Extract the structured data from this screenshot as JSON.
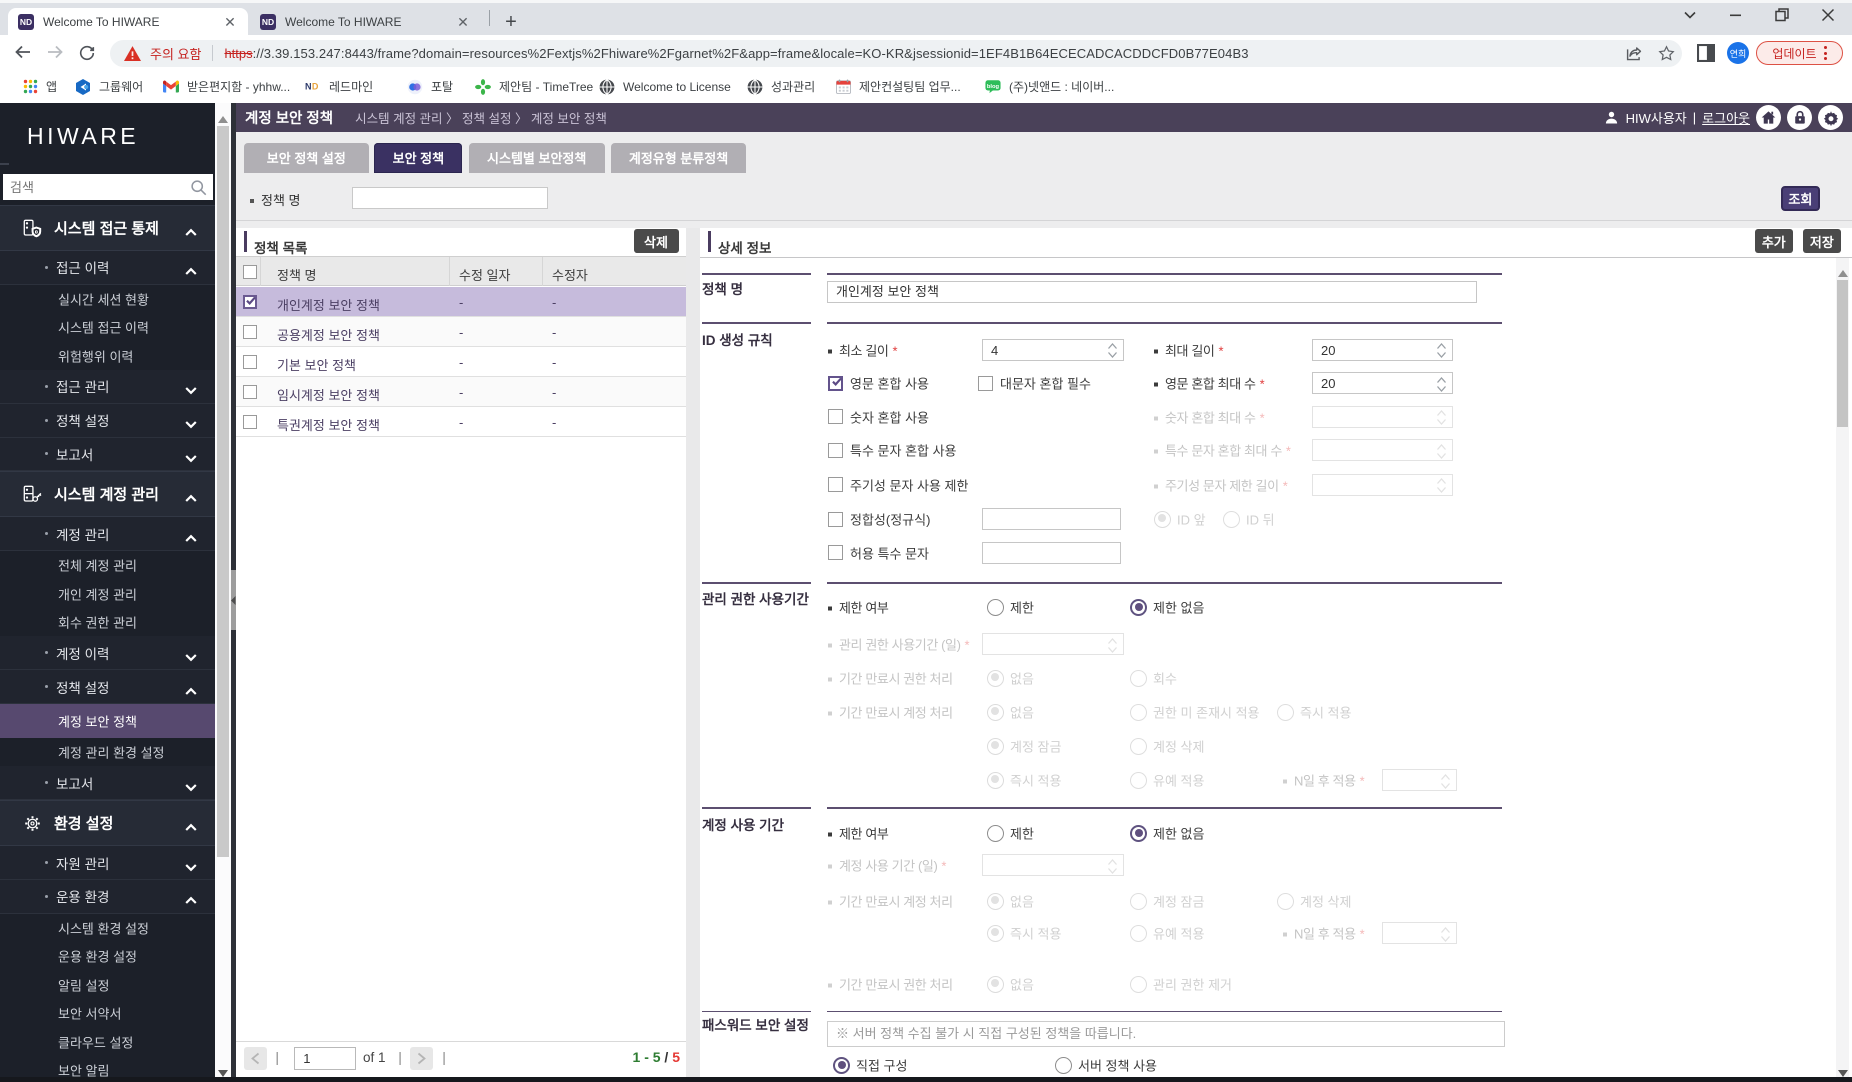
{
  "browser": {
    "tabs": [
      {
        "title": "Welcome To HIWARE",
        "favicon": "ND",
        "active": true
      },
      {
        "title": "Welcome To HIWARE",
        "favicon": "ND",
        "active": false
      }
    ],
    "new_tab_label": "+",
    "omnibox": {
      "warning_icon": "warning-triangle",
      "warning_text": "주의 요함",
      "scheme_struck": "https",
      "url_rest": "://3.39.153.247:8443/frame?domain=resources%2Fextjs%2Fhiware%2Fgarnet%2F&app=frame&locale=KO-KR&jsessionid=1EF4B1B64ECECADCACDDCFD0B77E04B3"
    },
    "avatar_label": "연희",
    "update_label": "업데이트",
    "bookmarks": [
      {
        "icon": "apps-grid",
        "label": "앱"
      },
      {
        "icon": "groupware",
        "label": "그룹웨어"
      },
      {
        "icon": "gmail",
        "label": "받은편지함 - yhhw..."
      },
      {
        "icon": "nd-logo",
        "label": "레드마인"
      },
      {
        "icon": "portal",
        "label": "포탈"
      },
      {
        "icon": "timetree",
        "label": "제안팀 - TimeTree"
      },
      {
        "icon": "globe",
        "label": "Welcome to License"
      },
      {
        "icon": "globe",
        "label": "성과관리"
      },
      {
        "icon": "calendar",
        "label": "제안컨설팅팀 업무..."
      },
      {
        "icon": "blog",
        "label": "(주)넷앤드 : 네이버..."
      }
    ]
  },
  "sidebar": {
    "logo": "HIWARE",
    "search_placeholder": "검색",
    "items": [
      {
        "type": "group",
        "icon": "server-shield",
        "label": "시스템 접근 통제",
        "chevron": "up"
      },
      {
        "type": "l2",
        "label": "접근 이력",
        "chevron": "up"
      },
      {
        "type": "l3",
        "label": "실시간 세션 현황"
      },
      {
        "type": "l3",
        "label": "시스템 접근 이력"
      },
      {
        "type": "l3",
        "label": "위험행위 이력"
      },
      {
        "type": "l2",
        "label": "접근 관리",
        "chevron": "down"
      },
      {
        "type": "l2",
        "label": "정책 설정",
        "chevron": "down"
      },
      {
        "type": "l2",
        "label": "보고서",
        "chevron": "down"
      },
      {
        "type": "group",
        "icon": "server-key",
        "label": "시스템 계정 관리",
        "chevron": "up"
      },
      {
        "type": "l2",
        "label": "계정 관리",
        "chevron": "up"
      },
      {
        "type": "l3",
        "label": "전체 계정 관리"
      },
      {
        "type": "l3",
        "label": "개인 계정 관리"
      },
      {
        "type": "l3",
        "label": "회수 권한 관리"
      },
      {
        "type": "l2",
        "label": "계정 이력",
        "chevron": "down"
      },
      {
        "type": "l2",
        "label": "정책 설정",
        "chevron": "up"
      },
      {
        "type": "l3",
        "label": "계정 보안 정책",
        "selected": true
      },
      {
        "type": "l3",
        "label": "계정 관리 환경 설정"
      },
      {
        "type": "l2",
        "label": "보고서",
        "chevron": "down"
      },
      {
        "type": "group",
        "icon": "gear",
        "label": "환경 설정",
        "chevron": "up"
      },
      {
        "type": "l2",
        "label": "자원 관리",
        "chevron": "down"
      },
      {
        "type": "l2",
        "label": "운용 환경",
        "chevron": "up"
      },
      {
        "type": "l3",
        "label": "시스템 환경 설정"
      },
      {
        "type": "l3",
        "label": "운용 환경 설정"
      },
      {
        "type": "l3",
        "label": "알림 설정"
      },
      {
        "type": "l3",
        "label": "보안 서약서"
      },
      {
        "type": "l3",
        "label": "클라우드 설정"
      },
      {
        "type": "l3",
        "label": "보안 알림"
      }
    ]
  },
  "header": {
    "title": "계정 보안 정책",
    "breadcrumb": "시스템 계정 관리 〉 정책 설정 〉 계정 보안 정책",
    "user_icon": "person",
    "user": "HIW사용자",
    "logout": "로그아웃",
    "icons": [
      "home",
      "lock",
      "gear"
    ]
  },
  "module_tabs": [
    {
      "label": "보안 정책 설정",
      "active": false
    },
    {
      "label": "보안 정책",
      "active": true
    },
    {
      "label": "시스템별 보안정책",
      "active": false
    },
    {
      "label": "계정유형 분류정책",
      "active": false
    }
  ],
  "filter": {
    "label": "정책 명",
    "value": "",
    "search_label": "조회"
  },
  "policy_list": {
    "title": "정책 목록",
    "delete_label": "삭제",
    "columns": [
      "정책 명",
      "수정 일자",
      "수정자"
    ],
    "rows": [
      {
        "name": "개인계정 보안 정책",
        "date": "-",
        "editor": "-",
        "checked": true,
        "selected": true
      },
      {
        "name": "공용계정 보안 정책",
        "date": "-",
        "editor": "-",
        "checked": false,
        "selected": false
      },
      {
        "name": "기본 보안 정책",
        "date": "-",
        "editor": "-",
        "checked": false,
        "selected": false
      },
      {
        "name": "임시계정 보안 정책",
        "date": "-",
        "editor": "-",
        "checked": false,
        "selected": false
      },
      {
        "name": "특권계정 보안 정책",
        "date": "-",
        "editor": "-",
        "checked": false,
        "selected": false
      }
    ],
    "pagination": {
      "page": "1",
      "of_label": "of 1",
      "range": "1 - 5",
      "slash": "/",
      "total": "5"
    }
  },
  "detail": {
    "title": "상세 정보",
    "add_label": "추가",
    "save_label": "저장",
    "sections": [
      {
        "title": "정책 명",
        "rows": [
          [
            {
              "k": "text",
              "v": "개인계정 보안 정책"
            }
          ]
        ]
      },
      {
        "title": "ID 생성 규칙",
        "rows": [
          [
            {
              "k": "blabel",
              "t": "최소 길이",
              "req": true
            },
            {
              "k": "spin",
              "v": "4"
            },
            {
              "k": "blabel2",
              "t": "최대 길이",
              "req": true
            },
            {
              "k": "spin2",
              "v": "20"
            }
          ],
          [
            {
              "k": "cb",
              "t": "영문 혼합 사용",
              "checked": true
            },
            {
              "k": "cb2",
              "t": "대문자 혼합 필수"
            },
            {
              "k": "blabel2",
              "t": "영문 혼합 최대 수",
              "req": true
            },
            {
              "k": "spin2",
              "v": "20"
            }
          ],
          [
            {
              "k": "cb",
              "t": "숫자 혼합 사용"
            },
            {
              "k": "blabel2",
              "t": "숫자 혼합 최대 수",
              "req": true,
              "dis": true
            },
            {
              "k": "spin2",
              "dis": true
            }
          ],
          [
            {
              "k": "cb",
              "t": "특수 문자 혼합 사용"
            },
            {
              "k": "blabel2",
              "t": "특수 문자 혼합 최대 수",
              "req": true,
              "dis": true
            },
            {
              "k": "spin2",
              "dis": true
            }
          ],
          [
            {
              "k": "cb",
              "t": "주기성 문자 사용 제한"
            },
            {
              "k": "blabel2",
              "t": "주기성 문자 제한 길이",
              "req": true,
              "dis": true
            },
            {
              "k": "spin2",
              "dis": true
            }
          ],
          [
            {
              "k": "cb",
              "t": "정합성(정규식)"
            },
            {
              "k": "smalltext"
            },
            {
              "k": "idradio1",
              "t": "ID 앞",
              "state": "dison"
            },
            {
              "k": "idradio2",
              "t": "ID 뒤",
              "state": "dis"
            }
          ],
          [
            {
              "k": "cb",
              "t": "허용 특수 문자"
            },
            {
              "k": "smalltext"
            }
          ]
        ]
      },
      {
        "title": "관리 권한 사용기간",
        "rows": [
          [
            {
              "k": "blabel",
              "t": "제한 여부"
            },
            {
              "k": "radioA",
              "t": "제한",
              "state": "off"
            },
            {
              "k": "radioB",
              "t": "제한 없음",
              "state": "on"
            }
          ],
          [
            {
              "k": "blabel",
              "t": "관리 권한 사용기간 (일)",
              "req": true,
              "dis": true
            },
            {
              "k": "spin",
              "dis": true
            }
          ],
          [
            {
              "k": "blabel",
              "t": "기간 만료시 권한 처리",
              "dis": true
            },
            {
              "k": "radioA",
              "t": "없음",
              "state": "dison"
            },
            {
              "k": "radioB",
              "t": "회수",
              "state": "dis"
            }
          ],
          [
            {
              "k": "blabel",
              "t": "기간 만료시 계정 처리",
              "dis": true
            },
            {
              "k": "radioA",
              "t": "없음",
              "state": "dison"
            },
            {
              "k": "radioB",
              "t": "권한 미 존재시 적용",
              "state": "dis"
            },
            {
              "k": "radioC",
              "t": "즉시 적용",
              "state": "dis"
            }
          ],
          [
            {
              "k": "radioA",
              "t": "계정 잠금",
              "state": "dison"
            },
            {
              "k": "radioB",
              "t": "계정 삭제",
              "state": "dis"
            }
          ],
          [
            {
              "k": "radioA",
              "t": "즉시 적용",
              "state": "dison"
            },
            {
              "k": "radioB",
              "t": "유예 적용",
              "state": "dis"
            },
            {
              "k": "nlabel",
              "t": "N일 후 적용",
              "req": true,
              "dis": true
            },
            {
              "k": "nspin",
              "dis": true
            }
          ]
        ]
      },
      {
        "title": "계정 사용 기간",
        "rows": [
          [
            {
              "k": "blabel",
              "t": "제한 여부"
            },
            {
              "k": "radioA",
              "t": "제한",
              "state": "off"
            },
            {
              "k": "radioB",
              "t": "제한 없음",
              "state": "on"
            }
          ],
          [
            {
              "k": "blabel",
              "t": "계정 사용 기간 (일)",
              "req": true,
              "dis": true
            },
            {
              "k": "spin",
              "dis": true
            }
          ],
          [
            {
              "k": "blabel",
              "t": "기간 만료시 계정 처리",
              "dis": true
            },
            {
              "k": "radioA",
              "t": "없음",
              "state": "dison"
            },
            {
              "k": "radioB",
              "t": "계정 잠금",
              "state": "dis"
            },
            {
              "k": "radioC",
              "t": "계정 삭제",
              "state": "dis"
            }
          ],
          [
            {
              "k": "radioA",
              "t": "즉시 적용",
              "state": "dison"
            },
            {
              "k": "radioB",
              "t": "유예 적용",
              "state": "dis"
            },
            {
              "k": "nlabel",
              "t": "N일 후 적용",
              "req": true,
              "dis": true
            },
            {
              "k": "nspin",
              "dis": true
            }
          ],
          [
            {
              "k": "blabel",
              "t": "기간 만료시 권한 처리",
              "dis": true
            },
            {
              "k": "radioA",
              "t": "없음",
              "state": "dison"
            },
            {
              "k": "radioB",
              "t": "관리 권한 제거",
              "state": "dis"
            }
          ]
        ]
      },
      {
        "title": "패스워드 보안 설정",
        "rows": [
          [
            {
              "k": "note",
              "v": "※ 서버 정책 수집 불가 시 직접 구성된 정책을 따릅니다."
            }
          ],
          [
            {
              "k": "pwradio1",
              "t": "직접 구성",
              "state": "on"
            },
            {
              "k": "pwradio2",
              "t": "서버 정책 사용",
              "state": "off"
            }
          ]
        ]
      }
    ]
  }
}
